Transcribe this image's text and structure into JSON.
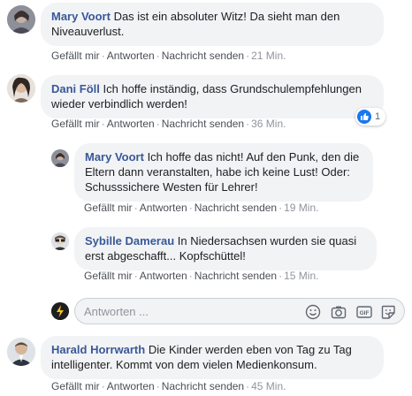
{
  "comments": [
    {
      "author": "Mary Voort",
      "text": "Das ist ein absoluter Witz! Da sieht man den Niveauverlust.",
      "like": "Gefällt mir",
      "reply": "Antworten",
      "message": "Nachricht senden",
      "time": "21 Min."
    },
    {
      "author": "Dani Föll",
      "text": "Ich hoffe inständig, dass Grundschulempfehlungen wieder verbindlich werden!",
      "like": "Gefällt mir",
      "reply": "Antworten",
      "message": "Nachricht senden",
      "time": "36 Min.",
      "reaction_count": "1"
    },
    {
      "author": "Mary Voort",
      "text": "Ich hoffe das nicht! Auf den Punk, den die Eltern dann veranstalten, habe ich keine Lust! Oder: Schusssichere Westen für Lehrer!",
      "like": "Gefällt mir",
      "reply": "Antworten",
      "message": "Nachricht senden",
      "time": "19 Min."
    },
    {
      "author": "Sybille Damerau",
      "text": "In Niedersachsen wurden sie quasi erst abgeschafft... Kopfschüttel!",
      "like": "Gefällt mir",
      "reply": "Antworten",
      "message": "Nachricht senden",
      "time": "15 Min."
    },
    {
      "author": "Harald Horrwarth",
      "text": "Die Kinder werden eben von Tag zu Tag intelligenter. Kommt von dem vielen Medienkonsum.",
      "like": "Gefällt mir",
      "reply": "Antworten",
      "message": "Nachricht senden",
      "time": "45 Min."
    }
  ],
  "reply_box": {
    "placeholder": "Antworten ...",
    "icons": [
      "emoji-icon",
      "camera-icon",
      "gif-icon",
      "sticker-icon"
    ]
  },
  "colors": {
    "author": "#385898",
    "bubble": "#f2f3f5",
    "meta": "#606770",
    "like_blue": "#1877f2"
  }
}
